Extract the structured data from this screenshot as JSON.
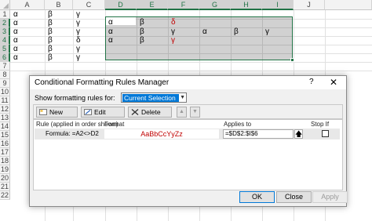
{
  "sheet": {
    "columns": [
      "A",
      "B",
      "C",
      "D",
      "E",
      "F",
      "G",
      "H",
      "I",
      "J"
    ],
    "rows": [
      "1",
      "2",
      "3",
      "4",
      "5",
      "6",
      "7",
      "8",
      "9",
      "10",
      "11",
      "12",
      "13",
      "14",
      "15",
      "16",
      "17",
      "18",
      "19",
      "20",
      "21",
      "22"
    ],
    "cells": {
      "A1": "α",
      "B1": "β",
      "C1": "γ",
      "A2": "α",
      "B2": "β",
      "C2": "γ",
      "D2": "α",
      "E2": "β",
      "F2": "δ",
      "A3": "α",
      "B3": "β",
      "C3": "γ",
      "D3": "α",
      "E3": "β",
      "F3": "γ",
      "G3": "α",
      "H3": "β",
      "I3": "γ",
      "A4": "α",
      "B4": "β",
      "C4": "δ",
      "D4": "α",
      "E4": "β",
      "F4": "γ",
      "A5": "α",
      "B5": "β",
      "C5": "γ",
      "A6": "α",
      "B6": "β",
      "C6": "γ"
    },
    "highlight_color": "#c00000",
    "accent_color": "#217346"
  },
  "dialog": {
    "title": "Conditional Formatting Rules Manager",
    "help": "?",
    "close": "✕",
    "show_label": "Show formatting rules for:",
    "scope_value": "Current Selection",
    "toolbar": {
      "new_rule": "New Rule...",
      "edit_rule": "Edit Rule...",
      "delete_rule": "Delete Rule",
      "move_up": "▲",
      "move_down": "▼"
    },
    "columns": {
      "rule": "Rule (applied in order shown)",
      "format": "Format",
      "applies_to": "Applies to",
      "stop_if_true": "Stop If True"
    },
    "rules": [
      {
        "rule": "Formula: =A2<>D2",
        "format_preview": "AaBbCcYyZz",
        "applies_to": "=$D$2:$I$6",
        "collapse_icon": "🡅",
        "stop_if_true": false
      }
    ],
    "buttons": {
      "ok": "OK",
      "close": "Close",
      "apply": "Apply"
    },
    "selection_color": "#0078d7"
  }
}
